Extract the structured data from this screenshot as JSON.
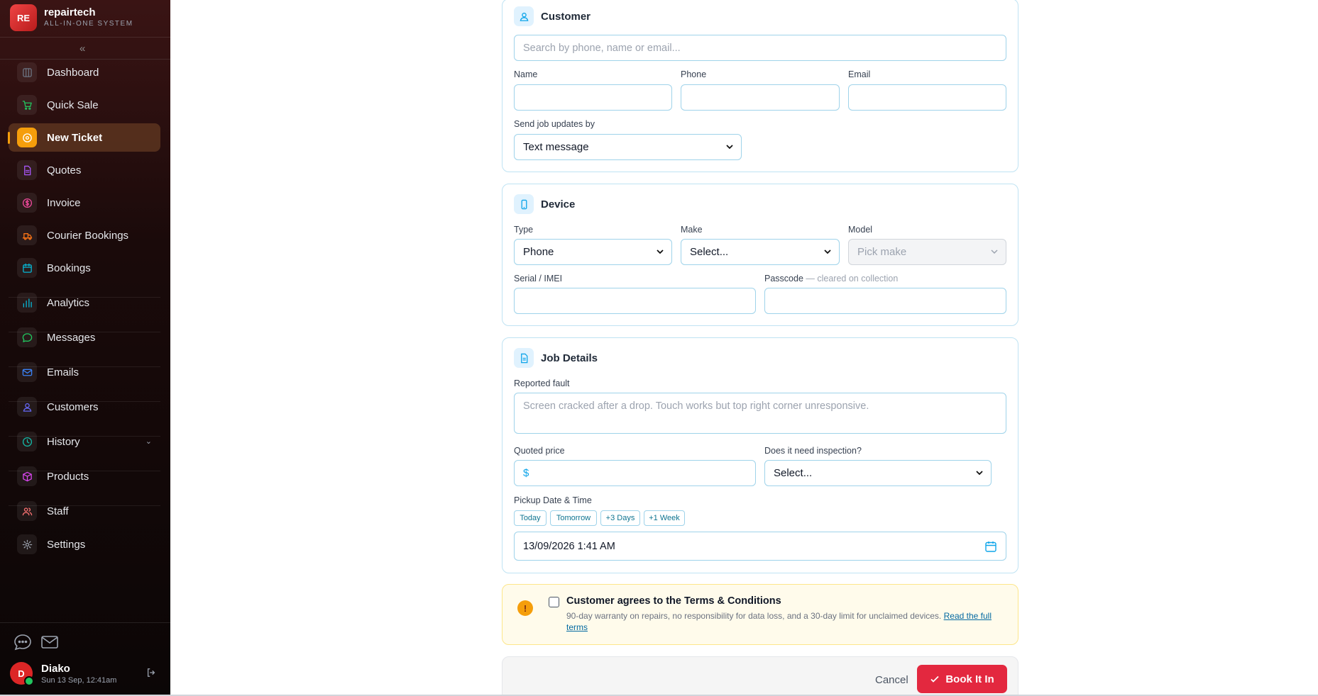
{
  "brand": {
    "logo": "RE",
    "name": "repairtech",
    "subtitle": "ALL-IN-ONE SYSTEM"
  },
  "sidebar": {
    "collapse_icon": "double-chevron-left",
    "items": [
      {
        "label": "Dashboard",
        "icon": "dashboard-icon",
        "color": "#6b7280"
      },
      {
        "label": "Quick Sale",
        "icon": "cart-icon",
        "color": "#22c55e"
      },
      {
        "label": "New Ticket",
        "icon": "ticket-icon",
        "color": "#f59e0b",
        "active": true
      },
      {
        "label": "Quotes",
        "icon": "document-icon",
        "color": "#a855f7"
      },
      {
        "label": "Invoice",
        "icon": "dollar-icon",
        "color": "#ec4899"
      },
      {
        "label": "Courier Bookings",
        "icon": "truck-icon",
        "color": "#f97316"
      },
      {
        "label": "Bookings",
        "icon": "calendar-icon",
        "color": "#06b6d4"
      },
      {
        "label": "Analytics",
        "icon": "bar-chart-icon",
        "color": "#06b6d4"
      },
      {
        "label": "Messages",
        "icon": "chat-icon",
        "color": "#22c55e"
      },
      {
        "label": "Emails",
        "icon": "mail-icon",
        "color": "#3b82f6"
      },
      {
        "label": "Customers",
        "icon": "user-icon",
        "color": "#6366f1"
      },
      {
        "label": "History",
        "icon": "clock-icon",
        "color": "#14b8a6",
        "expandable": true
      },
      {
        "label": "Products",
        "icon": "box-icon",
        "color": "#d946ef"
      },
      {
        "label": "Staff",
        "icon": "users-icon",
        "color": "#f87171"
      },
      {
        "label": "Settings",
        "icon": "gear-icon",
        "color": "#9ca3af"
      }
    ]
  },
  "user": {
    "initial": "D",
    "name": "Diako",
    "datetime": "Sun 13 Sep, 12:41am"
  },
  "customer": {
    "title": "Customer",
    "search_placeholder": "Search by phone, name or email...",
    "name_label": "Name",
    "phone_label": "Phone",
    "email_label": "Email",
    "updates_label": "Send job updates by",
    "updates_value": "Text message"
  },
  "device": {
    "title": "Device",
    "type_label": "Type",
    "type_value": "Phone",
    "make_label": "Make",
    "make_value": "Select...",
    "model_label": "Model",
    "model_value": "Pick make",
    "serial_label": "Serial / IMEI",
    "passcode_label": "Passcode",
    "passcode_hint": "— cleared on collection"
  },
  "job": {
    "title": "Job Details",
    "fault_label": "Reported fault",
    "fault_placeholder": "Screen cracked after a drop. Touch works but top right corner unresponsive.",
    "price_label": "Quoted price",
    "currency": "$",
    "inspection_label": "Does it need inspection?",
    "inspection_value": "Select...",
    "pickup_label": "Pickup Date & Time",
    "quick_picks": [
      "Today",
      "Tomorrow",
      "+3 Days",
      "+1 Week"
    ],
    "pickup_value": "13/09/2026 1:41 AM"
  },
  "terms": {
    "title": "Customer agrees to the Terms & Conditions",
    "body": "90-day warranty on repairs, no responsibility for data loss, and a 30-day limit for unclaimed devices.",
    "link": "Read the full terms"
  },
  "actions": {
    "cancel": "Cancel",
    "book": "Book It In"
  }
}
